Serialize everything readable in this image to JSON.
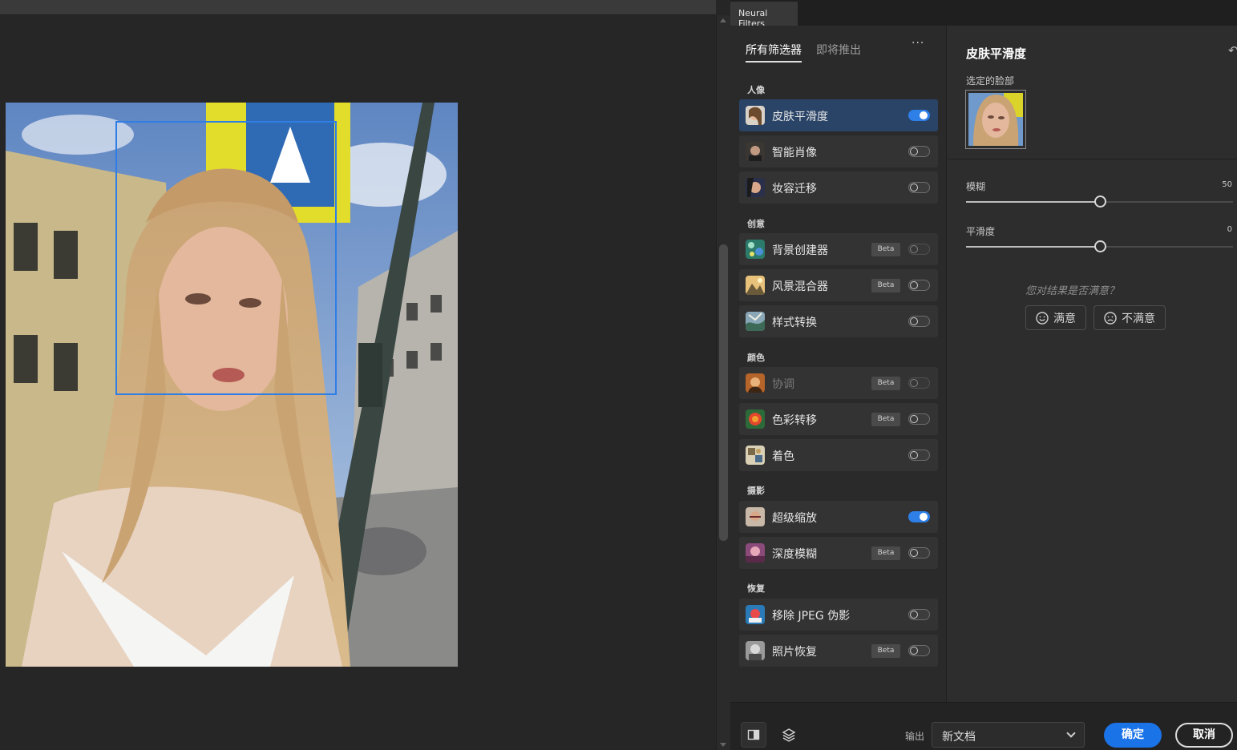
{
  "panel": {
    "tab_title": "Neural Filters"
  },
  "filters": {
    "tabs": [
      "所有筛选器",
      "即将推出"
    ],
    "more": "···",
    "groups": {
      "portrait": "人像",
      "creative": "创意",
      "color": "颜色",
      "photography": "摄影",
      "restore": "恢复"
    },
    "items": [
      {
        "name": "皮肤平滑度",
        "beta": false,
        "enabled": true,
        "selected": true
      },
      {
        "name": "智能肖像",
        "beta": false,
        "enabled": false
      },
      {
        "name": "妆容迁移",
        "beta": false,
        "enabled": false
      },
      {
        "name": "背景创建器",
        "beta": true,
        "enabled": false
      },
      {
        "name": "风景混合器",
        "beta": true,
        "enabled": false
      },
      {
        "name": "样式转换",
        "beta": false,
        "enabled": false
      },
      {
        "name": "协调",
        "beta": true,
        "enabled": false,
        "disabled": true
      },
      {
        "name": "色彩转移",
        "beta": true,
        "enabled": false
      },
      {
        "name": "着色",
        "beta": false,
        "enabled": false
      },
      {
        "name": "超级缩放",
        "beta": false,
        "enabled": true
      },
      {
        "name": "深度模糊",
        "beta": true,
        "enabled": false
      },
      {
        "name": "移除 JPEG 伪影",
        "beta": false,
        "enabled": false
      },
      {
        "name": "照片恢复",
        "beta": true,
        "enabled": false
      }
    ],
    "beta_label": "Beta"
  },
  "settings": {
    "title": "皮肤平滑度",
    "face_label": "选定的脸部",
    "sliders": [
      {
        "label": "模糊",
        "value": "50",
        "fraction": 0.5
      },
      {
        "label": "平滑度",
        "value": "0",
        "fraction": 0.5
      }
    ],
    "question": "您对结果是否满意？",
    "satisfied": "满意",
    "unsatisfied": "不满意"
  },
  "footer": {
    "output_label": "输出",
    "output_value": "新文档",
    "ok": "确定",
    "cancel": "取消"
  },
  "colors": {
    "accent": "#1b73e8",
    "face_box": "#2f7ee6"
  }
}
